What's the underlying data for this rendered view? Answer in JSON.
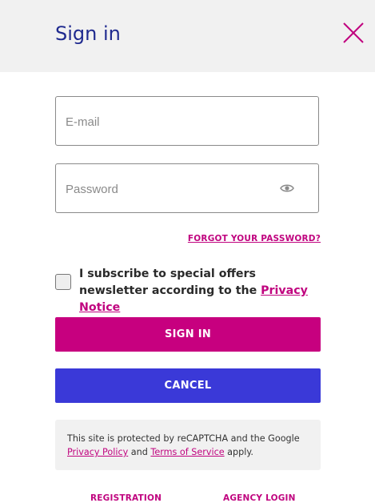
{
  "header": {
    "title": "Sign in"
  },
  "form": {
    "email": {
      "value": "",
      "placeholder": "E-mail"
    },
    "password": {
      "value": "",
      "placeholder": "Password"
    },
    "forgot_label": "FORGOT YOUR PASSWORD?",
    "newsletter": {
      "checked": false,
      "text_before": "I subscribe to special offers newsletter according to the ",
      "link_text": "Privacy Notice"
    },
    "signin_label": "SIGN IN",
    "cancel_label": "CANCEL"
  },
  "recaptcha": {
    "text_1": "This site is protected by reCAPTCHA and the Google ",
    "privacy_link": "Privacy Policy",
    "text_2": " and ",
    "terms_link": "Terms of Service",
    "text_3": " apply."
  },
  "footer": {
    "registration_label": "REGISTRATION",
    "agency_label": "AGENCY LOGIN"
  },
  "colors": {
    "primary": "#c7007f",
    "secondary": "#3a39d8",
    "title": "#1f2a8f",
    "header_bg": "#f1f1f1"
  },
  "icons": {
    "close": "close-icon",
    "eye": "eye-icon"
  }
}
